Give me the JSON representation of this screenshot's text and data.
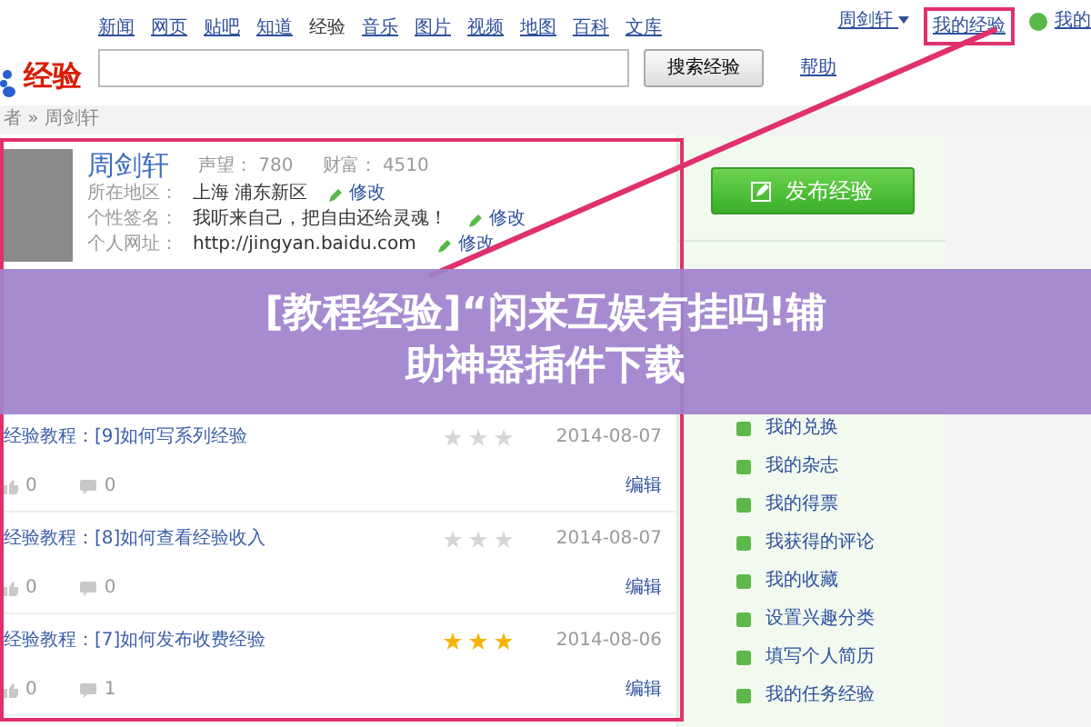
{
  "header": {
    "logo_text": "经验",
    "nav": [
      {
        "label": "新闻",
        "selected": false
      },
      {
        "label": "网页",
        "selected": false
      },
      {
        "label": "贴吧",
        "selected": false
      },
      {
        "label": "知道",
        "selected": false
      },
      {
        "label": "经验",
        "selected": true
      },
      {
        "label": "音乐",
        "selected": false
      },
      {
        "label": "图片",
        "selected": false
      },
      {
        "label": "视频",
        "selected": false
      },
      {
        "label": "地图",
        "selected": false
      },
      {
        "label": "百科",
        "selected": false
      },
      {
        "label": "文库",
        "selected": false
      }
    ],
    "search_button": "搜索经验",
    "help_link": "帮助",
    "user_name": "周剑轩",
    "my_experience": {
      "label": "我的经验",
      "highlighted": true
    },
    "cut_link": "我的"
  },
  "breadcrumb": "者 » 周剑轩",
  "profile": {
    "name": "周剑轩",
    "stats": [
      {
        "label": "声望：",
        "value": "780"
      },
      {
        "label": "财富：",
        "value": "4510"
      }
    ],
    "fields": [
      {
        "label": "所在地区：",
        "value": "上海 浦东新区",
        "action": "修改"
      },
      {
        "label": "个性签名：",
        "value": "我听来自己，把自由还给灵魂！",
        "action": "修改"
      },
      {
        "label": "个人网址：",
        "value": "http://jingyan.baidu.com",
        "action": "修改"
      }
    ]
  },
  "banner": {
    "lines": [
      "[教程经验]“闲来互娱有挂吗!辅",
      "助神器插件下载"
    ]
  },
  "experiences": [
    {
      "title": "经验教程：[9]如何写系列经验",
      "stars": 0,
      "date": "2014-08-07",
      "likes": "0",
      "comments": "0",
      "edit": "编辑"
    },
    {
      "title": "经验教程：[8]如何查看经验收入",
      "stars": 0,
      "date": "2014-08-07",
      "likes": "0",
      "comments": "0",
      "edit": "编辑"
    },
    {
      "title": "经验教程：[7]如何发布收费经验",
      "stars": 3,
      "date": "2014-08-06",
      "likes": "0",
      "comments": "1",
      "edit": "编辑"
    }
  ],
  "sidebar": {
    "publish_button": "发布经验",
    "menu": [
      "我的兑换",
      "我的杂志",
      "我的得票",
      "我获得的评论",
      "我的收藏",
      "设置兴趣分类",
      "填写个人简历",
      "我的任务经验"
    ]
  }
}
